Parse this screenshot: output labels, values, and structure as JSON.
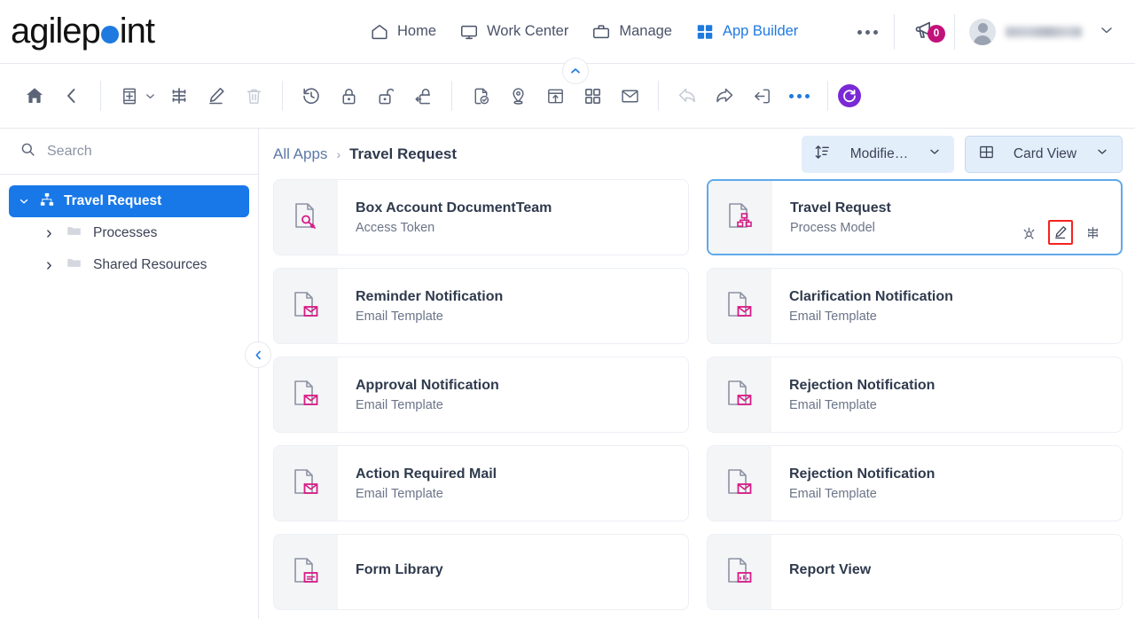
{
  "header": {
    "logo_text_a": "agilep",
    "logo_text_b": "int",
    "logo_dot": "logo-dot",
    "nav": [
      {
        "label": "Home",
        "icon": "home-icon",
        "active": false
      },
      {
        "label": "Work Center",
        "icon": "monitor-icon",
        "active": false
      },
      {
        "label": "Manage",
        "icon": "briefcase-icon",
        "active": false
      },
      {
        "label": "App Builder",
        "icon": "grid-icon",
        "active": true
      }
    ],
    "more_label": "...",
    "notification_count": "0",
    "notification_icon": "megaphone-icon",
    "avatar_icon": "user-avatar-icon",
    "user_name": "",
    "caret_icon": "chevron-down-icon",
    "collapse_icon": "chevron-up-icon",
    "accent_blue": "#1f7ae0",
    "badge_color": "#c2127a"
  },
  "toolbar": {
    "items": [
      {
        "name": "home-button",
        "icon": "home-filled-icon",
        "disabled": false
      },
      {
        "name": "back-button",
        "icon": "chevron-left-icon",
        "disabled": false
      },
      {
        "name": "new-button",
        "icon": "add-document-icon",
        "disabled": false,
        "has_caret": true
      },
      {
        "name": "properties-button",
        "icon": "properties-icon",
        "disabled": false
      },
      {
        "name": "edit-button",
        "icon": "pencil-icon",
        "disabled": false
      },
      {
        "name": "delete-button",
        "icon": "trash-icon",
        "disabled": true
      },
      {
        "name": "history-button",
        "icon": "history-icon",
        "disabled": false
      },
      {
        "name": "lock-button",
        "icon": "lock-icon",
        "disabled": false
      },
      {
        "name": "unlock-button",
        "icon": "unlock-icon",
        "disabled": false
      },
      {
        "name": "check-out-button",
        "icon": "lock-arrow-icon",
        "disabled": false
      },
      {
        "name": "validate-button",
        "icon": "document-check-icon",
        "disabled": false
      },
      {
        "name": "location-button",
        "icon": "map-pin-icon",
        "disabled": false
      },
      {
        "name": "publish-button",
        "icon": "publish-icon",
        "disabled": false
      },
      {
        "name": "apps-button",
        "icon": "grid-apps-icon",
        "disabled": false
      },
      {
        "name": "mail-button",
        "icon": "envelope-icon",
        "disabled": false
      },
      {
        "name": "undo-button",
        "icon": "undo-icon",
        "disabled": true
      },
      {
        "name": "redo-button",
        "icon": "redo-icon",
        "disabled": false
      },
      {
        "name": "export-button",
        "icon": "export-icon",
        "disabled": false
      },
      {
        "name": "more-button",
        "icon": "ellipsis-icon",
        "disabled": false
      },
      {
        "name": "refresh-button",
        "icon": "refresh-circle-icon",
        "disabled": false
      }
    ],
    "refresh_color": "#7a29d6"
  },
  "sidebar": {
    "search_placeholder": "Search",
    "search_value": "",
    "search_icon": "search-icon",
    "tree": [
      {
        "label": "Travel Request",
        "icon": "sitemap-icon",
        "twisty": "chevron-down-icon",
        "selected": true,
        "level": 0
      },
      {
        "label": "Processes",
        "icon": "folder-icon",
        "twisty": "chevron-right-icon",
        "selected": false,
        "level": 1
      },
      {
        "label": "Shared Resources",
        "icon": "folder-icon",
        "twisty": "chevron-right-icon",
        "selected": false,
        "level": 1
      }
    ],
    "collapse_icon": "chevron-left-icon",
    "selected_color": "#1878e8"
  },
  "main": {
    "breadcrumb": {
      "root": "All Apps",
      "separator": "›",
      "current": "Travel Request"
    },
    "sort_button": {
      "label": "Modifie…",
      "icon": "sort-icon",
      "caret": "chevron-down-icon"
    },
    "view_button": {
      "label": "Card View",
      "icon": "card-view-icon",
      "caret": "chevron-down-icon"
    },
    "cards": [
      {
        "title": "Box Account DocumentTeam",
        "subtitle": "Access Token",
        "icon": "document-key-icon",
        "selected": false,
        "actions": []
      },
      {
        "title": "Travel Request",
        "subtitle": "Process Model",
        "icon": "document-process-icon",
        "selected": true,
        "actions": [
          {
            "name": "run-model-button",
            "icon": "run-icon",
            "highlighted": false
          },
          {
            "name": "edit-model-button",
            "icon": "pencil-icon",
            "highlighted": true
          },
          {
            "name": "model-properties-button",
            "icon": "properties-icon",
            "highlighted": false
          }
        ]
      },
      {
        "title": "Reminder Notification",
        "subtitle": "Email Template",
        "icon": "document-mail-icon",
        "selected": false,
        "actions": []
      },
      {
        "title": "Clarification Notification",
        "subtitle": "Email Template",
        "icon": "document-mail-icon",
        "selected": false,
        "actions": []
      },
      {
        "title": "Approval Notification",
        "subtitle": "Email Template",
        "icon": "document-mail-icon",
        "selected": false,
        "actions": []
      },
      {
        "title": "Rejection Notification",
        "subtitle": "Email Template",
        "icon": "document-mail-icon",
        "selected": false,
        "actions": []
      },
      {
        "title": "Action Required Mail",
        "subtitle": "Email Template",
        "icon": "document-mail-icon",
        "selected": false,
        "actions": []
      },
      {
        "title": "Rejection Notification",
        "subtitle": "Email Template",
        "icon": "document-mail-icon",
        "selected": false,
        "actions": []
      },
      {
        "title": "Form Library",
        "subtitle": "",
        "icon": "document-form-icon",
        "selected": false,
        "actions": []
      },
      {
        "title": "Report View",
        "subtitle": "",
        "icon": "document-report-icon",
        "selected": false,
        "actions": []
      }
    ],
    "highlight_color": "#f5231f",
    "card_selected_border": "#5fa9ea"
  }
}
